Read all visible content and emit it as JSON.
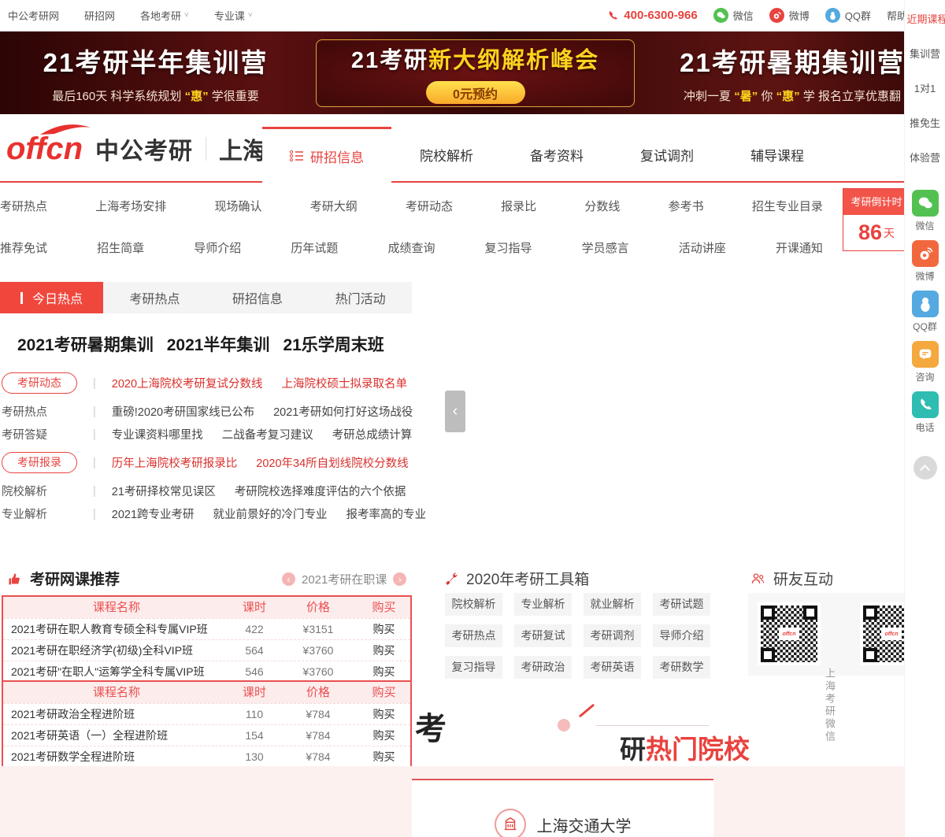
{
  "topbar": {
    "links": [
      "中公考研网",
      "研招网",
      "各地考研",
      "专业课"
    ],
    "phone": "400-6300-966",
    "social": [
      "微信",
      "微博",
      "QQ群",
      "帮助"
    ]
  },
  "banner": {
    "left": {
      "title": "21考研半年集训营",
      "sub_a": "最后160天 科学系统规划",
      "sub_b": "“惠”",
      "sub_c": "学很重要"
    },
    "mid": {
      "title_a": "21考研",
      "title_b": "新大纲解析峰会",
      "btn": "0元预约"
    },
    "right": {
      "title": "21考研暑期集训营",
      "sub_a": "冲刺一夏",
      "sub_b": "“暑”",
      "sub_c": "你",
      "sub_d": "“惠”",
      "sub_e": "学 报名立享优惠翻"
    }
  },
  "header": {
    "logo": "offcn",
    "brand": "中公考研",
    "city": "上海",
    "nav": [
      "研招信息",
      "院校解析",
      "备考资料",
      "复试调剂",
      "辅导课程"
    ]
  },
  "subnav": {
    "row1": [
      "考研热点",
      "上海考场安排",
      "现场确认",
      "考研大纲",
      "考研动态",
      "报录比",
      "分数线",
      "参考书",
      "招生专业目录"
    ],
    "row2": [
      "推荐免试",
      "招生简章",
      "导师介绍",
      "历年试题",
      "成绩查询",
      "复习指导",
      "学员感言",
      "活动讲座",
      "开课通知"
    ],
    "countdown": {
      "title": "考研倒计时",
      "days": "86",
      "unit": "天"
    }
  },
  "sidebar": {
    "hot": "近期课程",
    "quick": [
      "集训营",
      "1对1",
      "推免生",
      "体验营"
    ],
    "icons": [
      "微信",
      "微博",
      "QQ群",
      "咨询",
      "电话"
    ]
  },
  "hot": {
    "tabs": [
      "今日热点",
      "考研热点",
      "研招信息",
      "热门活动"
    ],
    "headlines": [
      "2021考研暑期集训",
      "2021半年集训",
      "21乐学周末班"
    ],
    "rows": [
      {
        "label": "考研动态",
        "links": [
          "2020上海院校考研复试分数线",
          "上海院校硕士拟录取名单"
        ]
      },
      {
        "label": "考研热点",
        "links": [
          "重磅!2020考研国家线已公布",
          "2021考研如何打好这场战役"
        ]
      },
      {
        "label": "考研答疑",
        "links": [
          "专业课资料哪里找",
          "二战备考复习建议",
          "考研总成绩计算"
        ]
      },
      {
        "label": "考研报录",
        "links": [
          "历年上海院校考研报录比",
          "2020年34所自划线院校分数线"
        ]
      },
      {
        "label": "院校解析",
        "links": [
          "21考研择校常见误区",
          "考研院校选择难度评估的六个依据"
        ]
      },
      {
        "label": "专业解析",
        "links": [
          "2021跨专业考研",
          "就业前景好的冷门专业",
          "报考率高的专业"
        ]
      }
    ]
  },
  "courses": {
    "title": "考研网课推荐",
    "carousel": "2021考研在职课",
    "headers": [
      "课程名称",
      "课时",
      "价格",
      "购买"
    ],
    "table1": [
      {
        "name": "2021考研在职人教育专硕全科专属VIP班",
        "hours": "422",
        "price": "¥3151",
        "buy": "购买"
      },
      {
        "name": "2021考研在职经济学(初级)全科VIP班",
        "hours": "564",
        "price": "¥3760",
        "buy": "购买"
      },
      {
        "name": "2021考研\"在职人\"运筹学全科专属VIP班",
        "hours": "546",
        "price": "¥3760",
        "buy": "购买"
      }
    ],
    "table2": [
      {
        "name": "2021考研政治全程进阶班",
        "hours": "110",
        "price": "¥784",
        "buy": "购买"
      },
      {
        "name": "2021考研英语（一）全程进阶班",
        "hours": "154",
        "price": "¥784",
        "buy": "购买"
      },
      {
        "name": "2021考研数学全程进阶班",
        "hours": "130",
        "price": "¥784",
        "buy": "购买"
      }
    ]
  },
  "toolbox": {
    "title": "2020年考研工具箱",
    "items": [
      "院校解析",
      "专业解析",
      "就业解析",
      "考研试题",
      "考研热点",
      "考研复试",
      "考研调剂",
      "导师介绍",
      "复习指导",
      "考研政治",
      "考研英语",
      "考研数学"
    ]
  },
  "interact": {
    "title": "研友互动",
    "caption": "上海考研微信"
  },
  "colleges": {
    "big": "考",
    "t_black": "研",
    "t_red": "热门院校",
    "item": "上海交通大学"
  },
  "colors": {
    "accent": "#e8433f",
    "banner_yellow": "#ffd21e",
    "wechat_green": "#52c152",
    "weibo_orange": "#f2683e",
    "qq_blue": "#54a9e0",
    "consult_orange": "#f5a83d",
    "phone_teal": "#2fbdb2"
  }
}
